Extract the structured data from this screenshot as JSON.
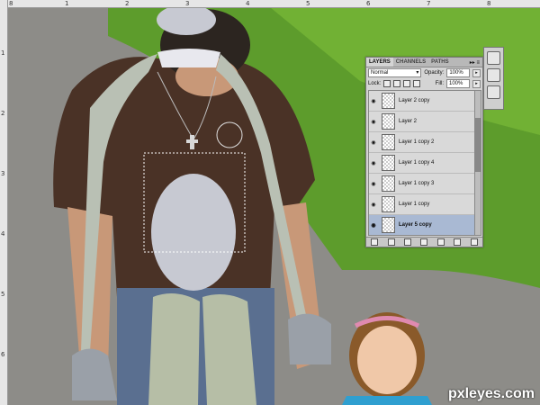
{
  "rulers": {
    "top_labels": [
      "8",
      "1",
      "2",
      "3",
      "4",
      "5",
      "6",
      "7",
      "8"
    ],
    "left_labels": [
      "1",
      "2",
      "3",
      "4",
      "5",
      "6"
    ]
  },
  "layers_panel": {
    "tabs": [
      {
        "label": "LAYERS",
        "active": true
      },
      {
        "label": "CHANNELS",
        "active": false
      },
      {
        "label": "PATHS",
        "active": false
      }
    ],
    "menu_glyph": "▸▸ ≡",
    "blend_mode": "Normal",
    "opacity_label": "Opacity:",
    "opacity_value": "100%",
    "lock_label": "Lock:",
    "fill_label": "Fill:",
    "fill_value": "100%",
    "layers": [
      {
        "name": "Layer 2 copy",
        "selected": false
      },
      {
        "name": "Layer 2",
        "selected": false
      },
      {
        "name": "Layer 1 copy 2",
        "selected": false
      },
      {
        "name": "Layer 1 copy 4",
        "selected": false
      },
      {
        "name": "Layer 1 copy 3",
        "selected": false
      },
      {
        "name": "Layer 1 copy",
        "selected": false
      },
      {
        "name": "Layer 5 copy",
        "selected": true
      }
    ]
  },
  "watermark": "pxleyes.com",
  "colors": {
    "gravel": "#8d8c88",
    "grass": "#5d9c2c",
    "shirt": "#4a3226",
    "jeans": "#5a6f90",
    "spoon": "#c7c9d2"
  }
}
